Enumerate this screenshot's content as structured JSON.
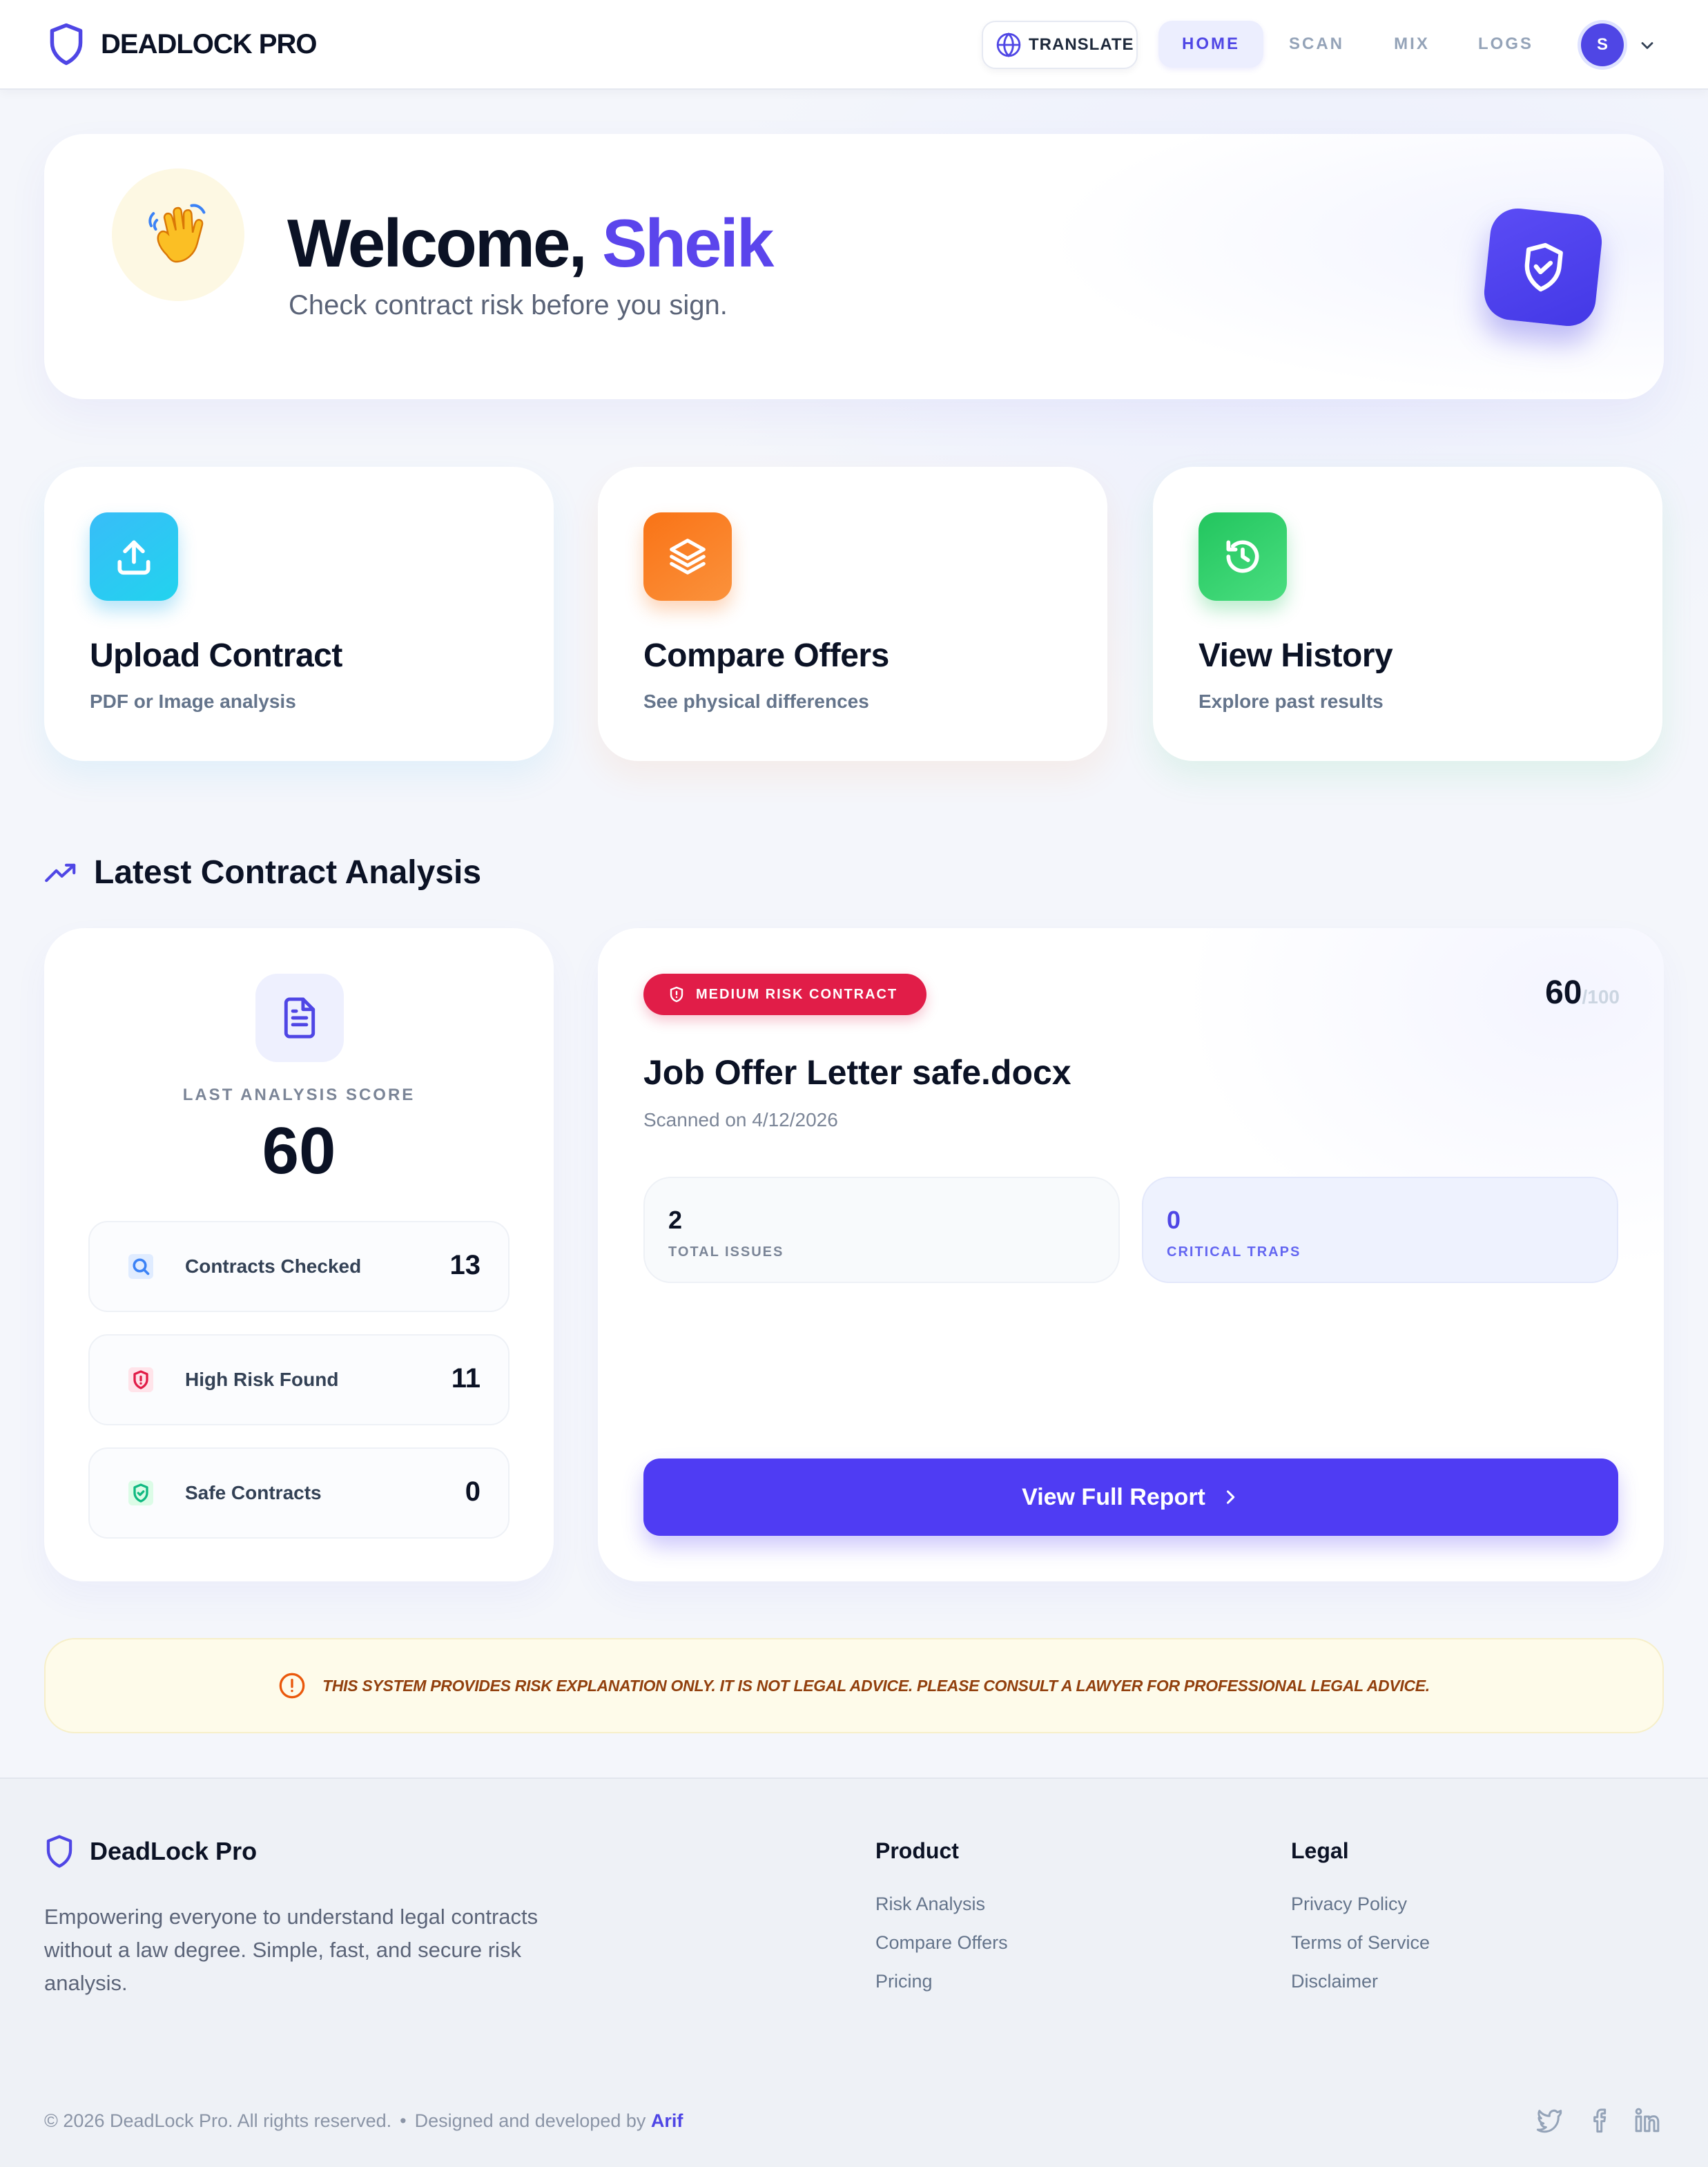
{
  "nav": {
    "brand": "DEADLOCK PRO",
    "translate_label": "TRANSLATE",
    "links": [
      "HOME",
      "SCAN",
      "MIX",
      "LOGS"
    ],
    "active_link": "HOME",
    "avatar_initial": "S"
  },
  "welcome": {
    "greeting": "Welcome,",
    "name": "Sheik",
    "subtitle": "Check contract risk before you sign."
  },
  "actions": [
    {
      "title": "Upload Contract",
      "subtitle": "PDF or Image analysis",
      "icon": "upload-icon",
      "color": "#22d3ee"
    },
    {
      "title": "Compare Offers",
      "subtitle": "See physical differences",
      "icon": "layers-icon",
      "color": "#f97316"
    },
    {
      "title": "View History",
      "subtitle": "Explore past results",
      "icon": "history-icon",
      "color": "#22c55e"
    }
  ],
  "section": {
    "title": "Latest Contract Analysis"
  },
  "score_card": {
    "label": "LAST ANALYSIS SCORE",
    "score": "60",
    "stats": [
      {
        "label": "Contracts Checked",
        "value": "13",
        "icon": "search-icon"
      },
      {
        "label": "High Risk Found",
        "value": "11",
        "icon": "shield-alert-icon"
      },
      {
        "label": "Safe Contracts",
        "value": "0",
        "icon": "shield-check-icon"
      }
    ]
  },
  "report": {
    "badge": "MEDIUM RISK CONTRACT",
    "score": "60",
    "score_max": "/100",
    "file_name": "Job Offer Letter safe.docx",
    "scanned": "Scanned on 4/12/2026",
    "metrics": [
      {
        "value": "2",
        "label": "TOTAL ISSUES"
      },
      {
        "value": "0",
        "label": "CRITICAL TRAPS"
      }
    ],
    "button_label": "View Full Report"
  },
  "disclaimer": "THIS SYSTEM PROVIDES RISK EXPLANATION ONLY. IT IS NOT LEGAL ADVICE. PLEASE CONSULT A LAWYER FOR PROFESSIONAL LEGAL ADVICE.",
  "footer": {
    "brand": "DeadLock Pro",
    "description": "Empowering everyone to understand legal contracts without a law degree. Simple, fast, and secure risk analysis.",
    "columns": [
      {
        "title": "Product",
        "links": [
          "Risk Analysis",
          "Compare Offers",
          "Pricing"
        ]
      },
      {
        "title": "Legal",
        "links": [
          "Privacy Policy",
          "Terms of Service",
          "Disclaimer"
        ]
      }
    ],
    "copyright": "© 2026 DeadLock Pro. All rights reserved.",
    "separator": "•",
    "designed_by": "Designed and developed by",
    "developer": "Arif",
    "social": [
      "twitter-icon",
      "facebook-icon",
      "linkedin-icon"
    ]
  },
  "colors": {
    "accent": "#4f46e5",
    "danger": "#e11d48",
    "warning_bg": "#fefbea",
    "warning_text": "#92400e"
  }
}
